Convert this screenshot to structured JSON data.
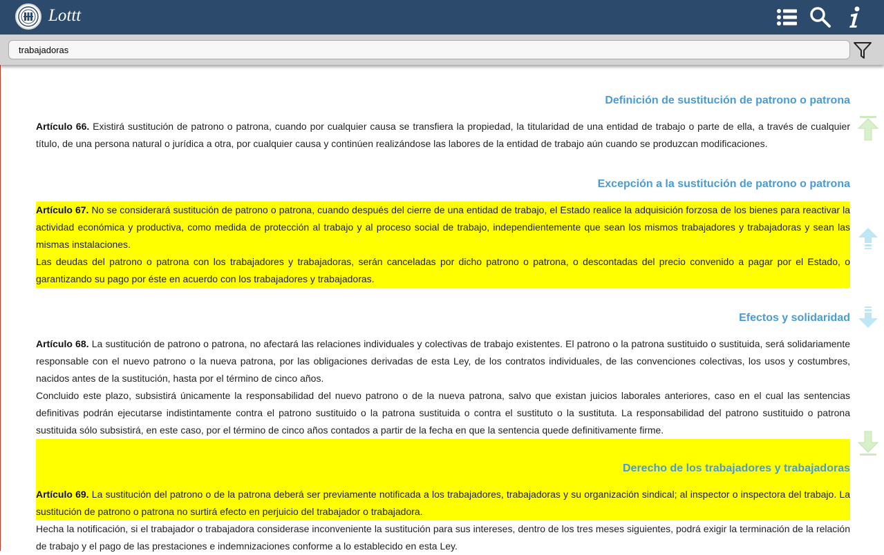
{
  "app": {
    "title": "Lottt"
  },
  "search": {
    "value": "trabajadoras"
  },
  "articles": [
    {
      "heading": "Definición de sustitución de patrono o patrona",
      "label": "Artículo 66.",
      "para1": " Existirá sustitución de patrono o patrona, cuando por cualquier causa se transfiera la propiedad, la titularidad de una entidad de trabajo o parte de ella, a través de cualquier título, de una persona natural o jurídica a otra, por cualquier causa y continúen realizándose las labores de la entidad de trabajo aún cuando se produzcan modificaciones."
    },
    {
      "heading": "Excepción a la sustitución de patrono o patrona",
      "label": "Artículo 67.",
      "para1": " No se considerará sustitución de patrono o patrona, cuando después del cierre de una entidad de trabajo, el Estado realice la adquisición forzosa de los bienes para reactivar la actividad económica y productiva, como medida de protección al trabajo y al proceso social de trabajo, independientemente que sean los mismos trabajadores y trabajadoras y sean las mismas instalaciones.",
      "para2": "Las deudas del patrono o patrona con los trabajadores y trabajadoras, serán canceladas por dicho patrono o patrona, o descontadas del precio convenido a pagar por el Estado, o garantizando su pago por éste en acuerdo con los trabajadores y trabajadoras."
    },
    {
      "heading": "Efectos y solidaridad",
      "label": "Artículo 68.",
      "para1": " La sustitución de patrono o patrona, no afectará las relaciones individuales y colectivas de trabajo existentes. El patrono o la patrona sustituido o sustituida, será solidariamente responsable con el nuevo patrono o la nueva patrona, por las obligaciones derivadas de esta Ley, de los contratos individuales, de las convenciones colectivas, los usos y costumbres, nacidos antes de la sustitución, hasta por el término de cinco años.",
      "para2": "Concluido este plazo, subsistirá únicamente la responsabilidad del nuevo patrono o de la nueva patrona, salvo que existan juicios laborales anteriores, caso en el cual las sentencias definitivas podrán ejecutarse indistintamente contra el patrono sustituido o la patrona sustituida o contra el sustituto o la sustituta. La responsabilidad del patrono sustituido o patrona sustituida sólo subsistirá, en este caso, por el término de cinco años contados a partir de la fecha en que la sentencia quede definitivamente firme."
    },
    {
      "heading": "Derecho de los trabajadores y trabajadoras",
      "label": "Artículo 69.",
      "para1": " La sustitución del patrono o de la patrona deberá ser previamente notificada a los trabajadores, trabajadoras y su organización sindical; al inspector o inspectora del trabajo. La sustitución de patrono o patrona no surtirá efecto en perjuicio del trabajador o trabajadora.",
      "para2": "Hecha la notificación, si el trabajador o trabajadora considerase inconveniente la sustitución para sus intereses, dentro de los tres meses siguientes, podrá exigir la terminación de la relación de trabajo y el pago de las prestaciones e indemnizaciones conforme a lo establecido en esta Ley."
    }
  ],
  "colors": {
    "header": "#2c4a6b",
    "highlight": "#ffff00",
    "heading": "#4a9bd4"
  }
}
